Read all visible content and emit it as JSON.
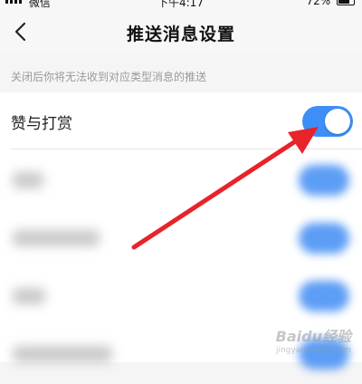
{
  "status_bar": {
    "carrier": "微信",
    "time": "下午4:17",
    "battery": "72%"
  },
  "nav": {
    "title": "推送消息设置"
  },
  "hint": "关闭后你将无法收到对应类型消息的推送",
  "settings": {
    "item": {
      "label": "赞与打赏",
      "enabled": true
    }
  },
  "colors": {
    "toggle_on": "#3d8ef7",
    "arrow": "#e8232a"
  },
  "icons": {
    "back": "chevron-left-icon"
  },
  "watermark": {
    "main": "Baidu经验",
    "sub": "jingyan.baidu.com"
  }
}
